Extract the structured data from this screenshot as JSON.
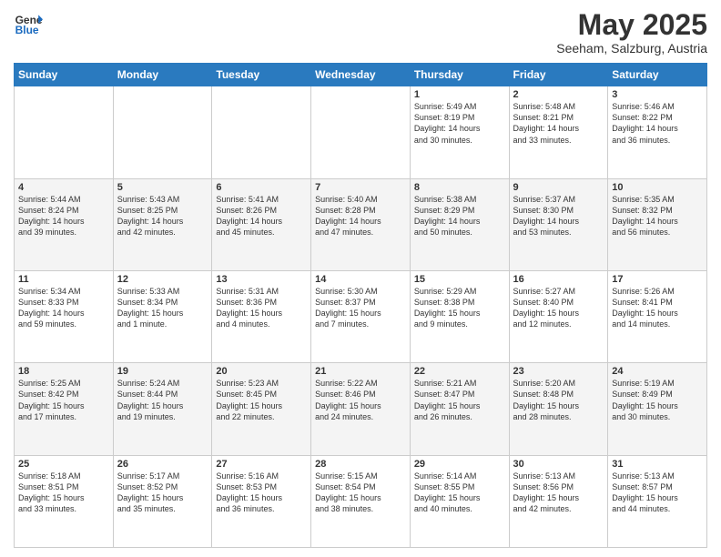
{
  "header": {
    "logo_general": "General",
    "logo_blue": "Blue",
    "month_title": "May 2025",
    "subtitle": "Seeham, Salzburg, Austria"
  },
  "weekdays": [
    "Sunday",
    "Monday",
    "Tuesday",
    "Wednesday",
    "Thursday",
    "Friday",
    "Saturday"
  ],
  "weeks": [
    [
      {
        "day": "",
        "info": ""
      },
      {
        "day": "",
        "info": ""
      },
      {
        "day": "",
        "info": ""
      },
      {
        "day": "",
        "info": ""
      },
      {
        "day": "1",
        "info": "Sunrise: 5:49 AM\nSunset: 8:19 PM\nDaylight: 14 hours\nand 30 minutes."
      },
      {
        "day": "2",
        "info": "Sunrise: 5:48 AM\nSunset: 8:21 PM\nDaylight: 14 hours\nand 33 minutes."
      },
      {
        "day": "3",
        "info": "Sunrise: 5:46 AM\nSunset: 8:22 PM\nDaylight: 14 hours\nand 36 minutes."
      }
    ],
    [
      {
        "day": "4",
        "info": "Sunrise: 5:44 AM\nSunset: 8:24 PM\nDaylight: 14 hours\nand 39 minutes."
      },
      {
        "day": "5",
        "info": "Sunrise: 5:43 AM\nSunset: 8:25 PM\nDaylight: 14 hours\nand 42 minutes."
      },
      {
        "day": "6",
        "info": "Sunrise: 5:41 AM\nSunset: 8:26 PM\nDaylight: 14 hours\nand 45 minutes."
      },
      {
        "day": "7",
        "info": "Sunrise: 5:40 AM\nSunset: 8:28 PM\nDaylight: 14 hours\nand 47 minutes."
      },
      {
        "day": "8",
        "info": "Sunrise: 5:38 AM\nSunset: 8:29 PM\nDaylight: 14 hours\nand 50 minutes."
      },
      {
        "day": "9",
        "info": "Sunrise: 5:37 AM\nSunset: 8:30 PM\nDaylight: 14 hours\nand 53 minutes."
      },
      {
        "day": "10",
        "info": "Sunrise: 5:35 AM\nSunset: 8:32 PM\nDaylight: 14 hours\nand 56 minutes."
      }
    ],
    [
      {
        "day": "11",
        "info": "Sunrise: 5:34 AM\nSunset: 8:33 PM\nDaylight: 14 hours\nand 59 minutes."
      },
      {
        "day": "12",
        "info": "Sunrise: 5:33 AM\nSunset: 8:34 PM\nDaylight: 15 hours\nand 1 minute."
      },
      {
        "day": "13",
        "info": "Sunrise: 5:31 AM\nSunset: 8:36 PM\nDaylight: 15 hours\nand 4 minutes."
      },
      {
        "day": "14",
        "info": "Sunrise: 5:30 AM\nSunset: 8:37 PM\nDaylight: 15 hours\nand 7 minutes."
      },
      {
        "day": "15",
        "info": "Sunrise: 5:29 AM\nSunset: 8:38 PM\nDaylight: 15 hours\nand 9 minutes."
      },
      {
        "day": "16",
        "info": "Sunrise: 5:27 AM\nSunset: 8:40 PM\nDaylight: 15 hours\nand 12 minutes."
      },
      {
        "day": "17",
        "info": "Sunrise: 5:26 AM\nSunset: 8:41 PM\nDaylight: 15 hours\nand 14 minutes."
      }
    ],
    [
      {
        "day": "18",
        "info": "Sunrise: 5:25 AM\nSunset: 8:42 PM\nDaylight: 15 hours\nand 17 minutes."
      },
      {
        "day": "19",
        "info": "Sunrise: 5:24 AM\nSunset: 8:44 PM\nDaylight: 15 hours\nand 19 minutes."
      },
      {
        "day": "20",
        "info": "Sunrise: 5:23 AM\nSunset: 8:45 PM\nDaylight: 15 hours\nand 22 minutes."
      },
      {
        "day": "21",
        "info": "Sunrise: 5:22 AM\nSunset: 8:46 PM\nDaylight: 15 hours\nand 24 minutes."
      },
      {
        "day": "22",
        "info": "Sunrise: 5:21 AM\nSunset: 8:47 PM\nDaylight: 15 hours\nand 26 minutes."
      },
      {
        "day": "23",
        "info": "Sunrise: 5:20 AM\nSunset: 8:48 PM\nDaylight: 15 hours\nand 28 minutes."
      },
      {
        "day": "24",
        "info": "Sunrise: 5:19 AM\nSunset: 8:49 PM\nDaylight: 15 hours\nand 30 minutes."
      }
    ],
    [
      {
        "day": "25",
        "info": "Sunrise: 5:18 AM\nSunset: 8:51 PM\nDaylight: 15 hours\nand 33 minutes."
      },
      {
        "day": "26",
        "info": "Sunrise: 5:17 AM\nSunset: 8:52 PM\nDaylight: 15 hours\nand 35 minutes."
      },
      {
        "day": "27",
        "info": "Sunrise: 5:16 AM\nSunset: 8:53 PM\nDaylight: 15 hours\nand 36 minutes."
      },
      {
        "day": "28",
        "info": "Sunrise: 5:15 AM\nSunset: 8:54 PM\nDaylight: 15 hours\nand 38 minutes."
      },
      {
        "day": "29",
        "info": "Sunrise: 5:14 AM\nSunset: 8:55 PM\nDaylight: 15 hours\nand 40 minutes."
      },
      {
        "day": "30",
        "info": "Sunrise: 5:13 AM\nSunset: 8:56 PM\nDaylight: 15 hours\nand 42 minutes."
      },
      {
        "day": "31",
        "info": "Sunrise: 5:13 AM\nSunset: 8:57 PM\nDaylight: 15 hours\nand 44 minutes."
      }
    ]
  ]
}
